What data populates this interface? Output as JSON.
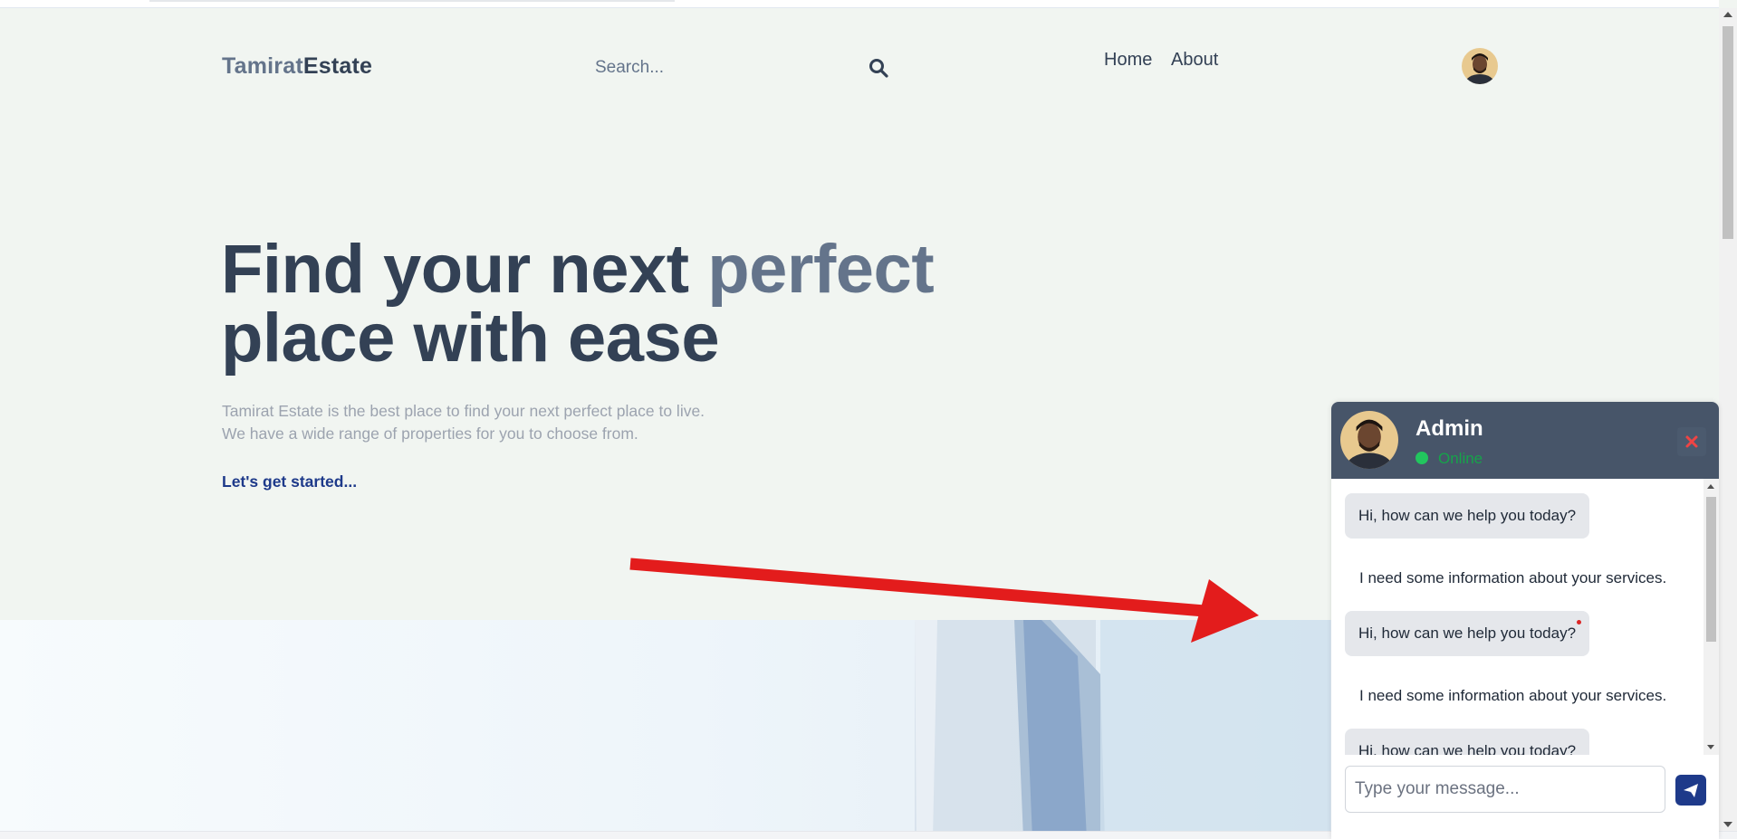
{
  "header": {
    "logo_part1": "Tamirat",
    "logo_part2": "Estate",
    "search_placeholder": "Search...",
    "nav": [
      {
        "label": "Home"
      },
      {
        "label": "About"
      }
    ]
  },
  "hero": {
    "title_line1_plain": "Find your next ",
    "title_line1_accent": "perfect",
    "title_line2": "place with ease",
    "desc_line1": "Tamirat Estate is the best place to find your next perfect place to live.",
    "desc_line2": "We have a wide range of properties for you to choose from.",
    "cta": "Let's get started..."
  },
  "chat": {
    "name": "Admin",
    "status": "Online",
    "messages": [
      {
        "from": "admin",
        "text": "Hi, how can we help you today?"
      },
      {
        "from": "user",
        "text": "I need some information about your services."
      },
      {
        "from": "admin",
        "text": "Hi, how can we help you today?"
      },
      {
        "from": "user",
        "text": "I need some information about your services."
      },
      {
        "from": "admin",
        "text": "Hi, how can we help you today?"
      }
    ],
    "input_placeholder": "Type your message..."
  },
  "icons": {
    "search": "search-icon",
    "close": "close-icon",
    "send": "send-icon",
    "avatar": "avatar"
  },
  "colors": {
    "background": "#f1f5f1",
    "logo_light": "#64748b",
    "logo_dark": "#334155",
    "hero_text": "#334155",
    "hero_accent": "#64748b",
    "cta": "#1e3a8a",
    "chat_header": "#475569",
    "online": "#22c55e",
    "close_icon": "#ef4444",
    "send_button": "#1e3a8a",
    "annotation_arrow": "#e31c1c"
  }
}
